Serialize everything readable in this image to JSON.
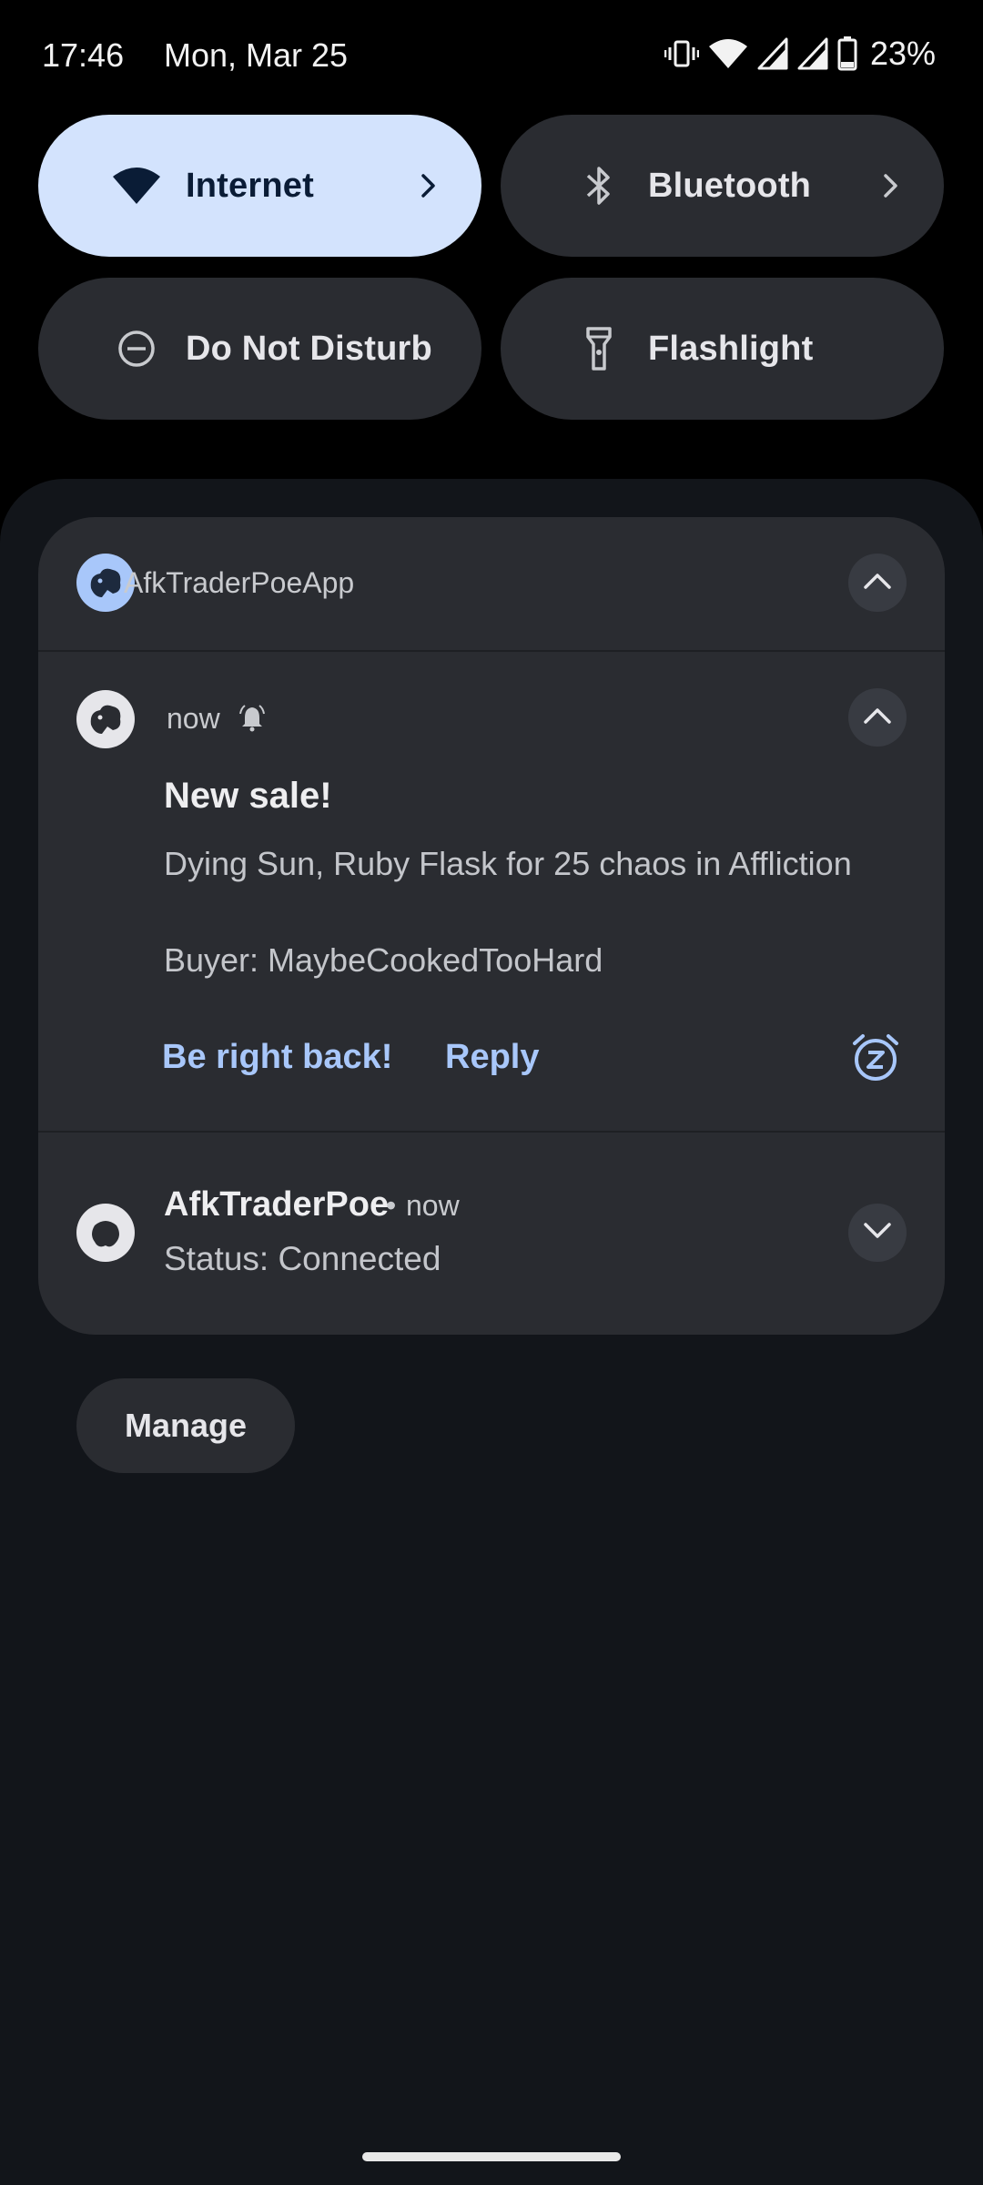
{
  "status_bar": {
    "time": "17:46",
    "date": "Mon, Mar 25",
    "battery_percent": "23%",
    "icons": [
      "vibrate-icon",
      "wifi-icon",
      "signal-icon",
      "signal-icon",
      "battery-icon"
    ]
  },
  "quick_settings": {
    "tiles": [
      {
        "label": "Internet",
        "icon": "wifi-icon",
        "state": "on",
        "has_chevron": true
      },
      {
        "label": "Bluetooth",
        "icon": "bluetooth-icon",
        "state": "off",
        "has_chevron": true
      },
      {
        "label": "Do Not Disturb",
        "icon": "dnd-icon",
        "state": "off",
        "has_chevron": false
      },
      {
        "label": "Flashlight",
        "icon": "flashlight-icon",
        "state": "off",
        "has_chevron": false
      }
    ]
  },
  "notification_group": {
    "app_name": "AfkTraderPoeApp",
    "notification": {
      "time": "now",
      "title": "New sale!",
      "body_line1": "Dying Sun, Ruby Flask for 25 chaos in Affliction",
      "body_line2": "Buyer: MaybeCookedTooHard",
      "actions": [
        "Be right back!",
        "Reply"
      ]
    }
  },
  "notification_2": {
    "app_name": "AfkTraderPoe",
    "separator": "•",
    "time": "now",
    "text": "Status: Connected"
  },
  "manage_label": "Manage",
  "colors": {
    "accent": "#a8c7fa",
    "active_tile": "#d3e3fd",
    "tile": "#2a2c31",
    "shade": "#12151a"
  }
}
